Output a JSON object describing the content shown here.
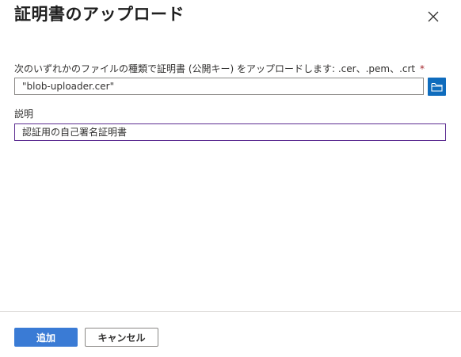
{
  "dialog": {
    "title": "証明書のアップロード"
  },
  "file_field": {
    "label": "次のいずれかのファイルの種類で証明書 (公開キー) をアップロードします: .cer、.pem、.crt",
    "required_marker": "*",
    "value": "\"blob-uploader.cer\""
  },
  "description_field": {
    "label": "説明",
    "value": "認証用の自己署名証明書"
  },
  "footer": {
    "add_label": "追加",
    "cancel_label": "キャンセル"
  },
  "icons": {
    "close": "close-icon",
    "browse": "folder-icon"
  },
  "colors": {
    "primary": "#3a7bd5",
    "required": "#a4262c",
    "focus_border": "#5c2d91",
    "browse_button": "#0f6cbd"
  }
}
